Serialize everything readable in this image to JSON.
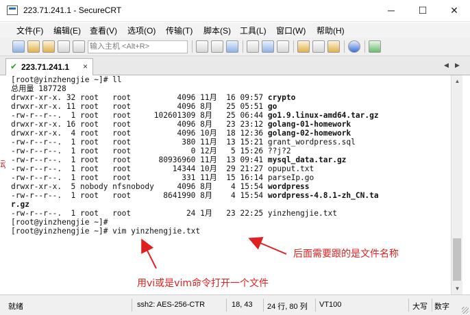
{
  "window": {
    "title": "223.71.241.1 - SecureCRT",
    "controls": {
      "minimize": "─",
      "maximize": "☐",
      "close": "✕"
    }
  },
  "menu": [
    "文件(F)",
    "编辑(E)",
    "查看(V)",
    "选项(O)",
    "传输(T)",
    "脚本(S)",
    "工具(L)",
    "窗口(W)",
    "帮助(H)"
  ],
  "toolbar": {
    "host_placeholder": "输入主机 <Alt+R>"
  },
  "tabs": [
    {
      "label": "223.71.241.1",
      "status_glyph": "✔",
      "close_glyph": "×"
    }
  ],
  "tab_nav": {
    "left": "◀",
    "right": "▶"
  },
  "terminal": {
    "lines": [
      {
        "text": "[root@yinzhengjie ~]# ll"
      },
      {
        "text": "总用量 187728"
      },
      {
        "text": "drwxr-xr-x. 32 root   root          4096 11月  16 09:57 ",
        "name": "crypto"
      },
      {
        "text": "drwxr-xr-x. 11 root   root          4096 8月   25 05:51 ",
        "name": "go"
      },
      {
        "text": "-rw-r--r--.  1 root   root     102601309 8月   25 06:44 ",
        "name": "go1.9.linux-amd64.tar.gz"
      },
      {
        "text": "drwxr-xr-x. 16 root   root          4096 8月   23 23:12 ",
        "name": "golang-01-homework"
      },
      {
        "text": "drwxr-xr-x.  4 root   root          4096 10月  18 12:36 ",
        "name": "golang-02-homework"
      },
      {
        "text": "-rw-r--r--.  1 root   root           380 11月  13 15:21 grant_wordpress.sql"
      },
      {
        "text": "-rw-r--r--.  1 root   root             0 12月   5 15:26 ??j?2"
      },
      {
        "text": "-rw-r--r--.  1 root   root      80936960 11月  13 09:41 ",
        "name": "mysql_data.tar.gz"
      },
      {
        "text": "-rw-r--r--.  1 root   root         14344 10月  29 21:27 opuput.txt"
      },
      {
        "text": "-rw-r--r--.  1 root   root           331 11月  15 16:14 parseIp.go"
      },
      {
        "text": "drwxr-xr-x.  5 nobody nfsnobody     4096 8月    4 15:54 ",
        "name": "wordpress"
      },
      {
        "text": "-rw-r--r--.  1 root   root       8641990 8月    4 15:54 ",
        "name": "wordpress-4.8.1-zh_CN.ta"
      },
      {
        "text": "",
        "name": "r.gz"
      },
      {
        "text": "-rw-r--r--.  1 root   root            24 1月   23 22:25 yinzhengjie.txt"
      },
      {
        "text": "[root@yinzhengjie ~]#"
      },
      {
        "text": "[root@yinzhengjie ~]# vim yinzhengjie.txt"
      }
    ]
  },
  "annotations": {
    "right_note": "后面需要跟的是文件名称",
    "bottom_note": "用vi或是vim命令打开一个文件",
    "left_fragment": "动",
    "color": "#e02020"
  },
  "statusbar": {
    "ready": "就绪",
    "protocol": "ssh2: AES-256-CTR",
    "cursor": "18, 43",
    "size": "24 行, 80 列",
    "terminal_type": "VT100",
    "caps": "大写",
    "num": "数字"
  }
}
